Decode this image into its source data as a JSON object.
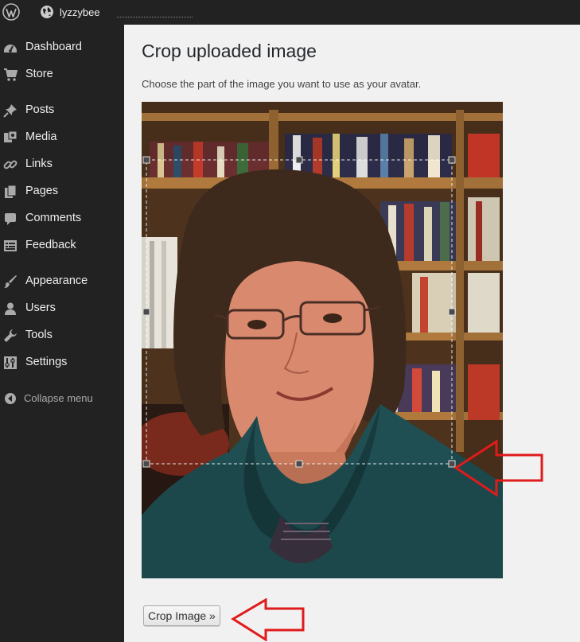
{
  "adminbar": {
    "site_name": "lyzzybee"
  },
  "sidebar": {
    "items": [
      {
        "label": "Dashboard",
        "icon": "dashboard-icon"
      },
      {
        "label": "Store",
        "icon": "cart-icon"
      },
      {
        "label": "Posts",
        "icon": "pin-icon"
      },
      {
        "label": "Media",
        "icon": "media-icon"
      },
      {
        "label": "Links",
        "icon": "link-icon"
      },
      {
        "label": "Pages",
        "icon": "pages-icon"
      },
      {
        "label": "Comments",
        "icon": "comment-icon"
      },
      {
        "label": "Feedback",
        "icon": "feedback-icon"
      },
      {
        "label": "Appearance",
        "icon": "brush-icon"
      },
      {
        "label": "Users",
        "icon": "user-icon"
      },
      {
        "label": "Tools",
        "icon": "wrench-icon"
      },
      {
        "label": "Settings",
        "icon": "settings-icon"
      }
    ],
    "collapse_label": "Collapse menu"
  },
  "main": {
    "title": "Crop uploaded image",
    "description": "Choose the part of the image you want to use as your avatar.",
    "crop_button_label": "Crop Image »"
  },
  "colors": {
    "admin_bg": "#222222",
    "page_bg": "#f1f1f1",
    "annotation_arrow": "#e01b1b"
  }
}
